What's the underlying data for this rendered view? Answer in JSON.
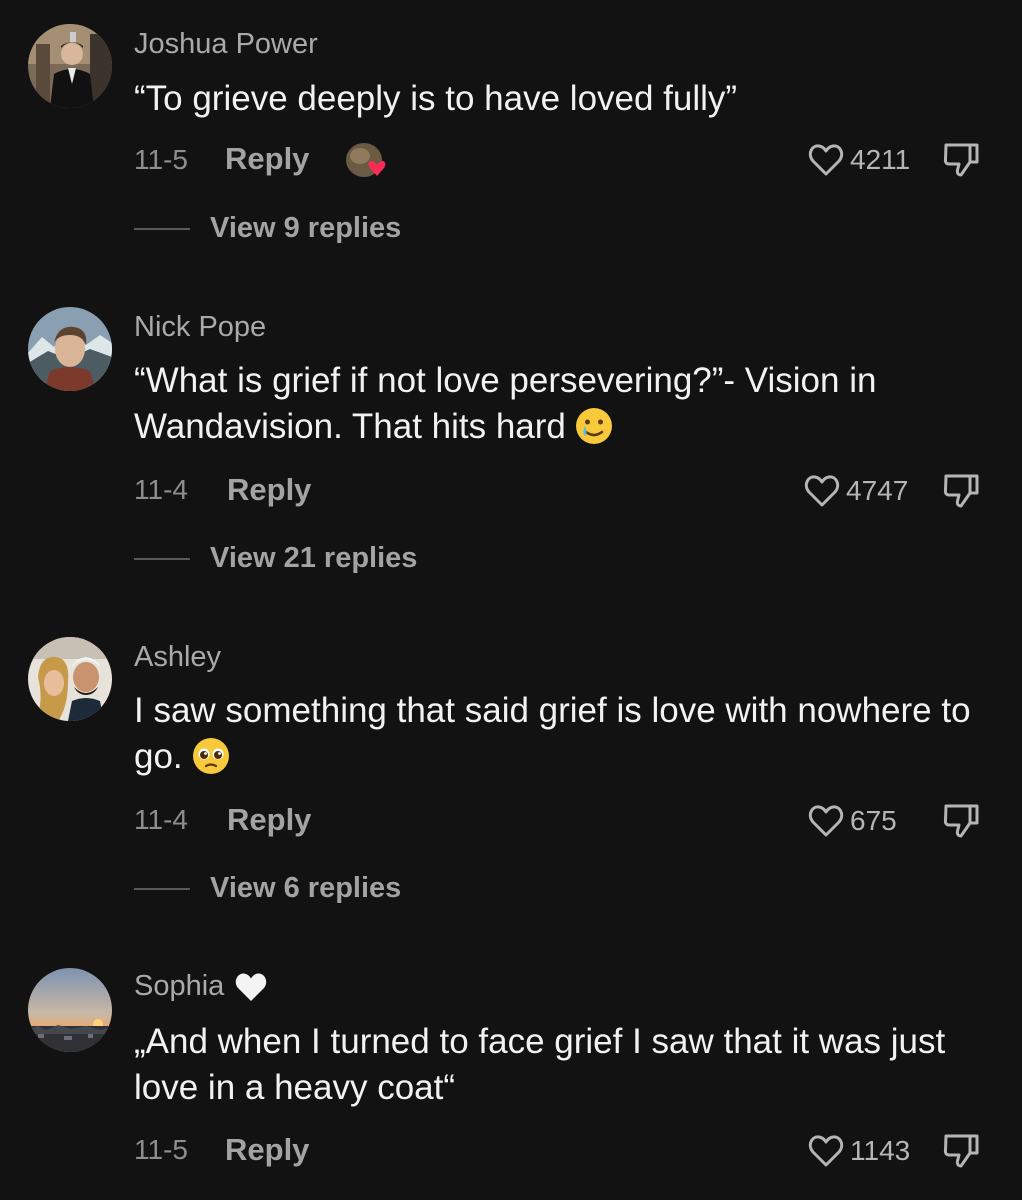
{
  "comments": [
    {
      "author": "Joshua Power",
      "text": "“To grieve deeply is to have loved fully”",
      "date": "11-5",
      "reply_label": "Reply",
      "likes": "4211",
      "view_replies": "View 9 replies",
      "avatar_icon": "man-in-suit-photo",
      "sticker_icon": "heart-sticker-icon"
    },
    {
      "author": "Nick Pope",
      "text": "“What is grief if not love persevering?”- Vision in Wandavision. That hits hard",
      "emoji": "crying-smile-emoji",
      "date": "11-4",
      "reply_label": "Reply",
      "likes": "4747",
      "view_replies": "View 21 replies",
      "avatar_icon": "man-mountains-photo"
    },
    {
      "author": "Ashley",
      "text": "I saw something that said grief is love with nowhere to go.",
      "emoji": "pleading-face-emoji",
      "date": "11-4",
      "reply_label": "Reply",
      "likes": "675",
      "view_replies": "View 6 replies",
      "avatar_icon": "couple-photo"
    },
    {
      "author": "Sophia",
      "author_badge": "white-heart-icon",
      "text": "„And when I turned to face grief I saw that it was just love in a heavy coat“",
      "date": "11-5",
      "reply_label": "Reply",
      "likes": "1143",
      "avatar_icon": "sunset-photo"
    }
  ],
  "colors": {
    "background": "#121212",
    "text": "#f2f2f2",
    "muted": "#a3a3a3",
    "heart_red": "#fe2c55"
  }
}
